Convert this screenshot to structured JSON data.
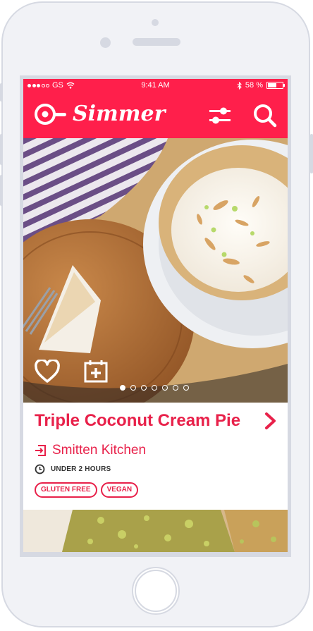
{
  "status_bar": {
    "carrier": "GS",
    "time": "9:41 AM",
    "battery": "58 %",
    "battery_level": 0.58,
    "signal_bars_filled": 3,
    "signal_bars_total": 5
  },
  "header": {
    "app_name": "Simmer",
    "icons": [
      "skillet-logo-icon",
      "filter-sliders-icon",
      "search-icon"
    ]
  },
  "recipe": {
    "title": "Triple Coconut Cream Pie",
    "source": "Smitten Kitchen",
    "time": "UNDER 2 HOURS",
    "tags": [
      "GLUTEN FREE",
      "VEGAN"
    ],
    "photo_page_count": 7,
    "photo_page_active": 1
  },
  "colors": {
    "brand": "#ff1f4b",
    "accent_text": "#e8214a",
    "device": "#d6d9e2"
  }
}
